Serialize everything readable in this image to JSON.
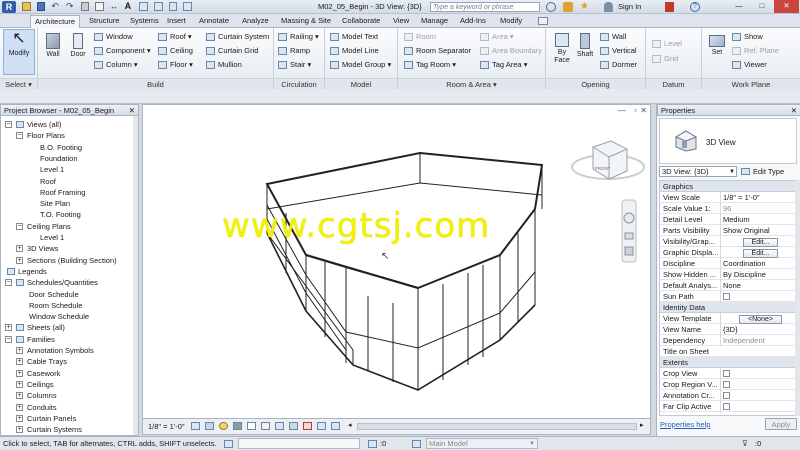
{
  "titlebar": {
    "title": "M02_05_Begin - 3D View: {3D}",
    "search_placeholder": "Type a keyword or phrase",
    "signin": "Sign In"
  },
  "tabs": [
    "Architecture",
    "Structure",
    "Systems",
    "Insert",
    "Annotate",
    "Analyze",
    "Massing & Site",
    "Collaborate",
    "View",
    "Manage",
    "Add-Ins",
    "Modify"
  ],
  "ribbon": {
    "select": {
      "modify": "Modify",
      "label": "Select"
    },
    "build": {
      "wall": "Wall",
      "door": "Door",
      "col1": [
        "Window",
        "Component",
        "Column"
      ],
      "col2": [
        "Roof",
        "Ceiling",
        "Floor"
      ],
      "col3": [
        "Curtain System",
        "Curtain Grid",
        "Mullion"
      ],
      "label": "Build"
    },
    "circulation": {
      "items": [
        "Railing",
        "Ramp",
        "Stair"
      ],
      "label": "Circulation"
    },
    "model": {
      "items": [
        "Model Text",
        "Model Line",
        "Model Group"
      ],
      "label": "Model"
    },
    "room_area": {
      "col1": [
        "Room",
        "Room Separator",
        "Tag Room"
      ],
      "col2": [
        "Area",
        "Area Boundary",
        "Tag Area"
      ],
      "label": "Room & Area"
    },
    "opening": {
      "byface": "By Face",
      "shaft": "Shaft",
      "items": [
        "Wall",
        "Vertical",
        "Dormer"
      ],
      "label": "Opening"
    },
    "datum": {
      "items": [
        "Level",
        "Grid"
      ],
      "label": "Datum"
    },
    "workplane": {
      "set": "Set",
      "items": [
        "Show",
        "Ref. Plane",
        "Viewer"
      ],
      "label": "Work Plane"
    }
  },
  "project_browser": {
    "header": "Project Browser - M02_05_Begin",
    "nodes": [
      {
        "text": "Views (all)",
        "lvl": 0,
        "tog": "-"
      },
      {
        "text": "Floor Plans",
        "lvl": 1,
        "tog": "-"
      },
      {
        "text": "B.O. Footing",
        "lvl": 3,
        "tog": ""
      },
      {
        "text": "Foundation",
        "lvl": 3,
        "tog": ""
      },
      {
        "text": "Level 1",
        "lvl": 3,
        "tog": ""
      },
      {
        "text": "Roof",
        "lvl": 3,
        "tog": ""
      },
      {
        "text": "Roof Framing",
        "lvl": 3,
        "tog": ""
      },
      {
        "text": "Site Plan",
        "lvl": 3,
        "tog": ""
      },
      {
        "text": "T.O. Footing",
        "lvl": 3,
        "tog": ""
      },
      {
        "text": "Ceiling Plans",
        "lvl": 1,
        "tog": "-"
      },
      {
        "text": "Level 1",
        "lvl": 3,
        "tog": ""
      },
      {
        "text": "3D Views",
        "lvl": 1,
        "tog": "+"
      },
      {
        "text": "Sections (Building Section)",
        "lvl": 1,
        "tog": "+"
      },
      {
        "text": "Legends",
        "lvl": 0,
        "tog": ""
      },
      {
        "text": "Schedules/Quantities",
        "lvl": 0,
        "tog": "-"
      },
      {
        "text": "Door Schedule",
        "lvl": 2,
        "tog": ""
      },
      {
        "text": "Room Schedule",
        "lvl": 2,
        "tog": ""
      },
      {
        "text": "Window Schedule",
        "lvl": 2,
        "tog": ""
      },
      {
        "text": "Sheets (all)",
        "lvl": 0,
        "tog": "+"
      },
      {
        "text": "Families",
        "lvl": 0,
        "tog": "-"
      },
      {
        "text": "Annotation Symbols",
        "lvl": 1,
        "tog": "+"
      },
      {
        "text": "Cable Trays",
        "lvl": 1,
        "tog": "+"
      },
      {
        "text": "Casework",
        "lvl": 1,
        "tog": "+"
      },
      {
        "text": "Ceilings",
        "lvl": 1,
        "tog": "+"
      },
      {
        "text": "Columns",
        "lvl": 1,
        "tog": "+"
      },
      {
        "text": "Conduits",
        "lvl": 1,
        "tog": "+"
      },
      {
        "text": "Curtain Panels",
        "lvl": 1,
        "tog": "+"
      },
      {
        "text": "Curtain Systems",
        "lvl": 1,
        "tog": "+"
      }
    ]
  },
  "viewport": {
    "watermark": "www.cgtsj.com",
    "viewcube_label": "FRONT",
    "scale": "1/8\" = 1'-0\""
  },
  "properties": {
    "header": "Properties",
    "type_name": "3D View",
    "selector": "3D View: {3D}",
    "edit_type": "Edit Type",
    "groups": [
      {
        "name": "Graphics",
        "rows": [
          {
            "k": "View Scale",
            "v": "1/8\" = 1'-0\""
          },
          {
            "k": "Scale Value 1:",
            "v": "96",
            "gray": true
          },
          {
            "k": "Detail Level",
            "v": "Medium"
          },
          {
            "k": "Parts Visibility",
            "v": "Show Original"
          },
          {
            "k": "Visibility/Grap...",
            "v": "Edit...",
            "btn": true
          },
          {
            "k": "Graphic Displa...",
            "v": "Edit...",
            "btn": true
          },
          {
            "k": "Discipline",
            "v": "Coordination"
          },
          {
            "k": "Show Hidden ...",
            "v": "By Discipline"
          },
          {
            "k": "Default Analys...",
            "v": "None"
          },
          {
            "k": "Sun Path",
            "v": "",
            "chk": true
          }
        ]
      },
      {
        "name": "Identity Data",
        "rows": [
          {
            "k": "View Template",
            "v": "<None>",
            "btn": true
          },
          {
            "k": "View Name",
            "v": "{3D}"
          },
          {
            "k": "Dependency",
            "v": "Independent",
            "gray": true
          },
          {
            "k": "Title on Sheet",
            "v": ""
          }
        ]
      },
      {
        "name": "Extents",
        "rows": [
          {
            "k": "Crop View",
            "v": "",
            "chk": true
          },
          {
            "k": "Crop Region V...",
            "v": "",
            "chk": true
          },
          {
            "k": "Annotation Cr...",
            "v": "",
            "chk": true
          },
          {
            "k": "Far Clip Active",
            "v": "",
            "chk": true
          }
        ]
      }
    ],
    "help": "Properties help",
    "apply": "Apply"
  },
  "status": {
    "message": "Click to select, TAB for alternates, CTRL adds, SHIFT unselects.",
    "zero": ":0",
    "model": "Main Model"
  }
}
